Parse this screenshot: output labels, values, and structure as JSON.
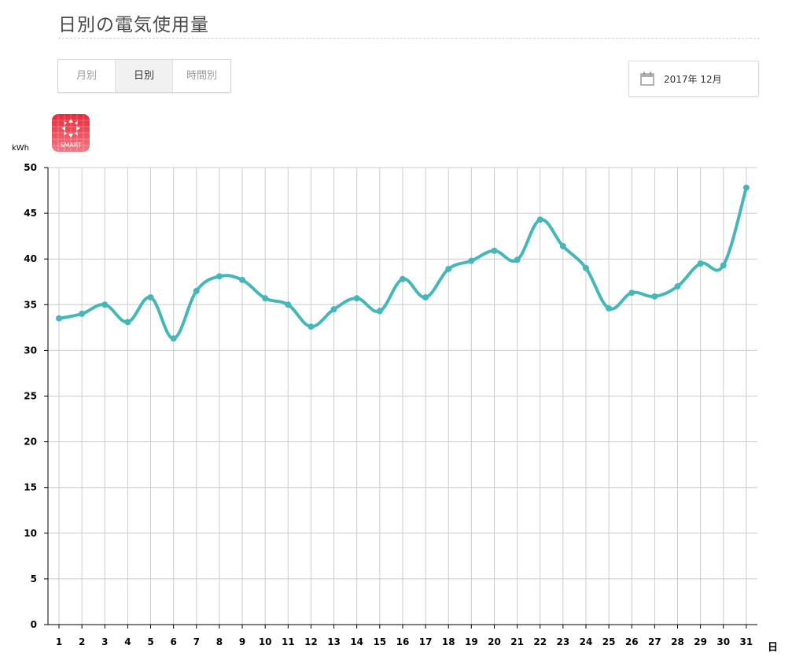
{
  "header": {
    "title": "日別の電気使用量"
  },
  "tabs": [
    {
      "label": "月別",
      "active": false
    },
    {
      "label": "日別",
      "active": true
    },
    {
      "label": "時間別",
      "active": false
    }
  ],
  "date_picker": {
    "value": "2017年  12月",
    "icon": "calendar-icon"
  },
  "logo": {
    "text": "SMART",
    "color": "#e03040"
  },
  "colors": {
    "line": "#45b7b9",
    "grid": "#cccccc"
  },
  "chart_data": {
    "type": "line",
    "ylabel": "kWh",
    "xlabel": "日",
    "ylim": [
      0,
      50
    ],
    "yticks": [
      0,
      5,
      10,
      15,
      20,
      25,
      30,
      35,
      40,
      45,
      50
    ],
    "grid": true,
    "categories": [
      "1",
      "2",
      "3",
      "4",
      "5",
      "6",
      "7",
      "8",
      "9",
      "10",
      "11",
      "12",
      "13",
      "14",
      "15",
      "16",
      "17",
      "18",
      "19",
      "20",
      "21",
      "22",
      "23",
      "24",
      "25",
      "26",
      "27",
      "28",
      "29",
      "30",
      "31"
    ],
    "values": [
      33.5,
      34.0,
      35.0,
      33.1,
      35.8,
      31.3,
      36.5,
      38.1,
      37.7,
      35.7,
      35.0,
      32.6,
      34.5,
      35.7,
      34.3,
      37.8,
      35.8,
      38.9,
      39.8,
      40.9,
      39.9,
      44.3,
      41.4,
      39.0,
      34.6,
      36.3,
      35.9,
      37.0,
      39.5,
      39.3,
      47.8
    ]
  }
}
